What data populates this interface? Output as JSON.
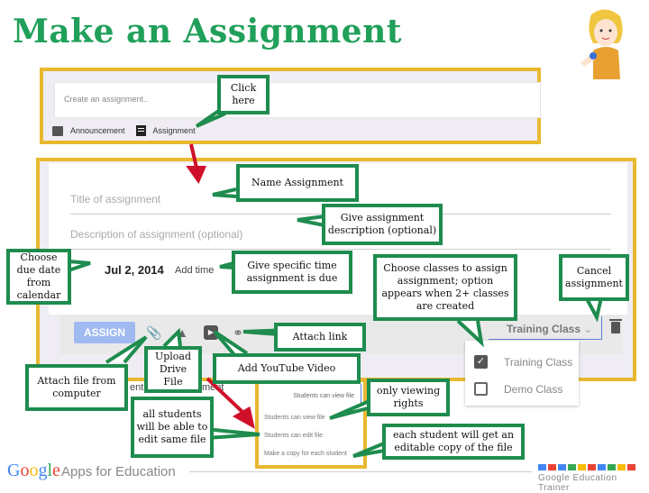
{
  "title": "Make an Assignment",
  "panel1": {
    "placeholder": "Create an assignment..",
    "tabs": [
      "Announcement",
      "Assignment"
    ]
  },
  "form": {
    "title_placeholder": "Title of assignment",
    "description_placeholder": "Description of assignment (optional)",
    "due_date": "Jul 2, 2014",
    "add_time_label": "Add time",
    "assign_button": "ASSIGN",
    "class_select": "Training Class",
    "toolbar_icons": [
      "paperclip-icon",
      "drive-icon",
      "youtube-icon",
      "link-icon"
    ],
    "behind_text_1": "ent",
    "behind_text_2": "ment"
  },
  "class_dropdown": {
    "options": [
      {
        "label": "Training Class",
        "checked": true
      },
      {
        "label": "Demo Class",
        "checked": false
      }
    ]
  },
  "sharing_dropdown": {
    "selected": "Students can view file",
    "options": [
      "Students can view file",
      "Students can edit file",
      "Make a copy for each student"
    ]
  },
  "callouts": {
    "click_here": "Click here",
    "name_assignment": "Name Assignment",
    "give_description": "Give assignment description (optional)",
    "choose_due_date": "Choose due date from calendar",
    "specific_time": "Give specific time assignment is due",
    "choose_classes": "Choose classes to assign assignment; option appears when 2+ classes are created",
    "cancel": "Cancel assignment",
    "attach_link": "Attach link",
    "attach_file": "Attach file from computer",
    "upload_drive": "Upload Drive File",
    "add_youtube": "Add YouTube Video",
    "all_students_edit": "all students will be able to edit same file",
    "only_viewing": "only viewing rights",
    "each_student_copy": "each student will get an editable copy of the file"
  },
  "footer": {
    "google": [
      "G",
      "o",
      "o",
      "g",
      "l",
      "e"
    ],
    "google_colors": [
      "#4285f4",
      "#ea4335",
      "#fbbc05",
      "#4285f4",
      "#34a853",
      "#ea4335"
    ],
    "apps_label": "Apps for Education",
    "trainer_label": "Google Education Trainer",
    "square_colors": [
      "#4285f4",
      "#ea4335",
      "#4285f4",
      "#34a853",
      "#fbbc05",
      "#ea4335",
      "#4285f4",
      "#34a853",
      "#fbbc05",
      "#ea4335"
    ]
  },
  "colors": {
    "accent_green": "#1e8c4e",
    "panel_border": "#e8b830",
    "arrow_red": "#d0102a"
  }
}
